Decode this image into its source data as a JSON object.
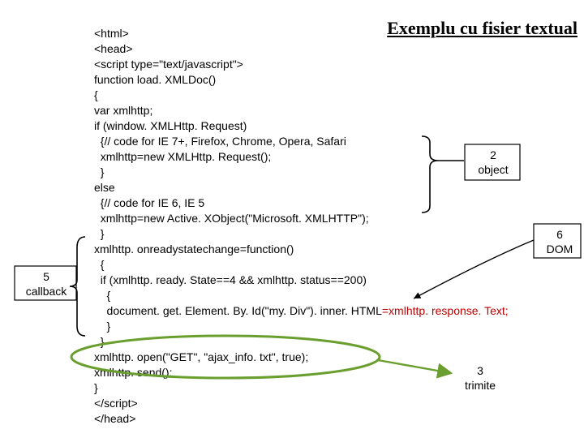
{
  "title": "Exemplu cu fisier textual",
  "code_lines": [
    "<html>",
    "<head>",
    "<script type=\"text/javascript\">",
    "function load. XMLDoc()",
    "{",
    "var xmlhttp;",
    "if (window. XMLHttp. Request)",
    "  {// code for IE 7+, Firefox, Chrome, Opera, Safari",
    "  xmlhttp=new XMLHttp. Request();",
    "  }",
    "else",
    "  {// code for IE 6, IE 5",
    "  xmlhttp=new Active. XObject(\"Microsoft. XMLHTTP\");",
    "  }",
    "xmlhttp. onreadystatechange=function()",
    "  {",
    "  if (xmlhttp. ready. State==4 && xmlhttp. status==200)",
    "    {",
    "    document. get. Element. By. Id(\"my. Div\"). inner. HTML",
    "    }",
    "  }",
    "xmlhttp. open(\"GET\", \"ajax_info. txt\", true);",
    "xmlhttp. send();",
    "}",
    "</script>",
    "</head>"
  ],
  "red_tail": "=xmlhttp. response. Text;",
  "labels": {
    "l2a": "2",
    "l2b": "object",
    "l3a": "3",
    "l3b": "trimite",
    "l5a": "5",
    "l5b": "callback",
    "l6a": "6",
    "l6b": "DOM"
  }
}
